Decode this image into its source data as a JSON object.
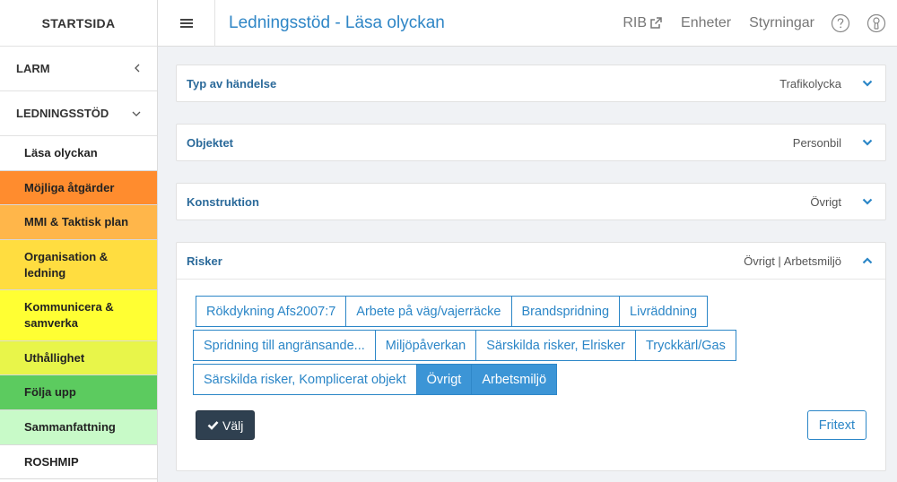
{
  "sidebar": {
    "brand": "STARTSIDA",
    "sections": [
      {
        "label": "LARM",
        "chevron": "‹"
      },
      {
        "label": "LEDNINGSSTÖD",
        "chevron": "⌄"
      }
    ],
    "items": [
      {
        "label": "Läsa olyckan",
        "color": "#ffffff"
      },
      {
        "label": "Möjliga åtgärder",
        "color": "#ff8c2e"
      },
      {
        "label": "MMI & Taktisk plan",
        "color": "#ffb64a"
      },
      {
        "label": "Organisation & ledning",
        "color": "#ffdd40"
      },
      {
        "label": "Kommunicera & samverka",
        "color": "#ffff33"
      },
      {
        "label": "Uthållighet",
        "color": "#e8f54a"
      },
      {
        "label": "Följa upp",
        "color": "#5ccb5f"
      },
      {
        "label": "Sammanfattning",
        "color": "#c8fac8"
      },
      {
        "label": "ROSHMIP",
        "color": "#ffffff"
      }
    ]
  },
  "header": {
    "title": "Ledningsstöd - Läsa olyckan",
    "links": {
      "rib": "RIB",
      "enheter": "Enheter",
      "styrningar": "Styrningar"
    }
  },
  "panels": [
    {
      "title": "Typ av händelse",
      "value": "Trafikolycka",
      "expanded": false
    },
    {
      "title": "Objektet",
      "value": "Personbil",
      "expanded": false
    },
    {
      "title": "Konstruktion",
      "value": "Övrigt",
      "expanded": false
    },
    {
      "title": "Risker",
      "value": "Övrigt | Arbetsmiljö",
      "expanded": true
    }
  ],
  "risker": {
    "rows": [
      [
        {
          "label": "Rökdykning Afs2007:7",
          "selected": false
        },
        {
          "label": "Arbete på väg/vajerräcke",
          "selected": false
        },
        {
          "label": "Brandspridning",
          "selected": false
        },
        {
          "label": "Livräddning",
          "selected": false
        }
      ],
      [
        {
          "label": "Spridning till angränsande...",
          "selected": false
        },
        {
          "label": "Miljöpåverkan",
          "selected": false
        },
        {
          "label": "Särskilda risker, Elrisker",
          "selected": false
        },
        {
          "label": "Tryckkärl/Gas",
          "selected": false
        }
      ],
      [
        {
          "label": "Särskilda risker, Komplicerat objekt",
          "selected": false
        },
        {
          "label": "Övrigt",
          "selected": true
        },
        {
          "label": "Arbetsmiljö",
          "selected": true
        }
      ]
    ],
    "valj_label": "Välj",
    "fritext_label": "Fritext"
  },
  "colors": {
    "accent": "#2f86c6",
    "panel_title": "#2b6a9a",
    "dark_button": "#2f4050",
    "selected": "#3c95d6"
  }
}
